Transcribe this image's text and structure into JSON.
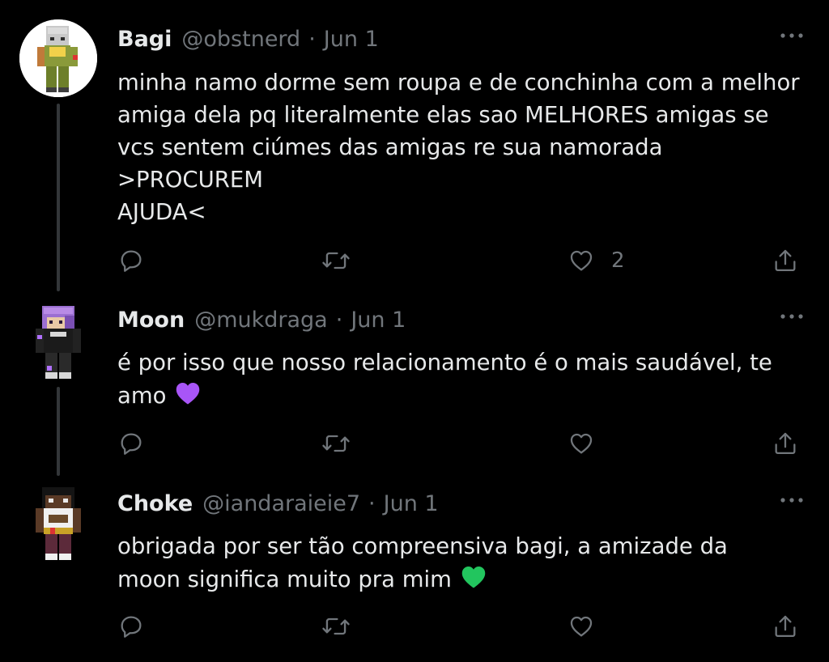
{
  "colors": {
    "background": "#000000",
    "text": "#e7e9ea",
    "muted": "#71767b",
    "thread_line": "#333639"
  },
  "tweets": [
    {
      "name": "Bagi",
      "handle": "@obstnerd",
      "separator": "·",
      "date": "Jun 1",
      "avatar_icon": "minecraft-skin-avatar-icon",
      "lines": [
        "minha namo dorme sem roupa e de conchinha com a melhor",
        "amiga dela pq literalmente elas sao MELHORES amigas se",
        "vcs sentem ciúmes das amigas re sua namorada",
        ">PROCUREM",
        "AJUDA<"
      ],
      "like_count": "2"
    },
    {
      "name": "Moon",
      "handle": "@mukdraga",
      "separator": "·",
      "date": "Jun 1",
      "avatar_icon": "minecraft-skin-avatar-icon",
      "lines": [
        "é por isso que nosso relacionamento é o mais saudável, te",
        "amo"
      ],
      "emoji": "purple-heart-icon"
    },
    {
      "name": "Choke",
      "handle": "@iandaraieie7",
      "separator": "·",
      "date": "Jun 1",
      "avatar_icon": "minecraft-skin-avatar-icon",
      "lines": [
        "obrigada por ser tão compreensiva bagi, a amizade da",
        "moon significa muito pra mim"
      ],
      "emoji": "green-heart-icon"
    }
  ],
  "icons": {
    "more": "more-horizontal-icon",
    "reply": "reply-icon",
    "retweet": "retweet-icon",
    "like": "heart-icon",
    "share": "share-icon"
  }
}
